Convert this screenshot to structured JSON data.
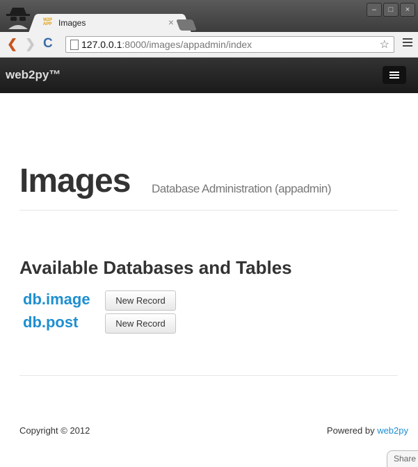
{
  "browser": {
    "tab_title": "Images",
    "tab_favicon_text": "W2P APP",
    "tab_close": "×",
    "url_host": "127.0.0.1",
    "url_rest": ":8000/images/appadmin/index",
    "window_buttons": [
      "–",
      "□",
      "×"
    ]
  },
  "navbar": {
    "brand": "web2py™"
  },
  "page": {
    "title": "Images",
    "subtitle": "Database Administration (appadmin)",
    "section_heading": "Available Databases and Tables",
    "tables": [
      {
        "name": "db.image",
        "button": "New Record"
      },
      {
        "name": "db.post",
        "button": "New Record"
      }
    ]
  },
  "footer": {
    "copyright": "Copyright © 2012",
    "powered_prefix": "Powered by ",
    "powered_link": "web2py",
    "share": "Share"
  },
  "colors": {
    "link": "#1f8fd0",
    "navbar": "#222222",
    "back_arrow": "#c8551b"
  }
}
